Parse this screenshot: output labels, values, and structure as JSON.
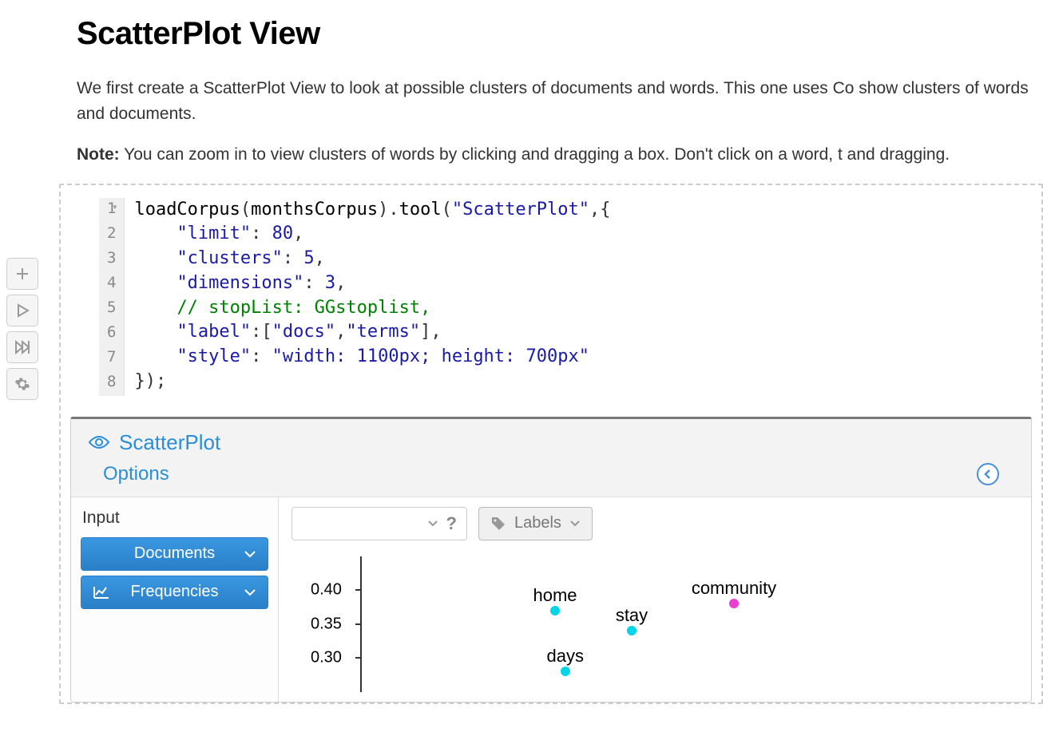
{
  "heading": "ScatterPlot View",
  "paragraph1": "We first create a ScatterPlot View to look at possible clusters of documents and words. This one uses Co show clusters of words and documents.",
  "note_label": "Note:",
  "note_text": " You can zoom in to view clusters of words by clicking and dragging a box. Don't click on a word, t and dragging.",
  "code": {
    "line_numbers": [
      "1",
      "2",
      "3",
      "4",
      "5",
      "6",
      "7",
      "8"
    ],
    "fn1": "loadCorpus",
    "arg1": "monthsCorpus",
    "fn2": "tool",
    "tool_name": "\"ScatterPlot\"",
    "k_limit": "\"limit\"",
    "v_limit": "80",
    "k_clusters": "\"clusters\"",
    "v_clusters": "5",
    "k_dimensions": "\"dimensions\"",
    "v_dimensions": "3",
    "comment": "// stopList: GGstoplist,",
    "k_label": "\"label\"",
    "v_label_a": "\"docs\"",
    "v_label_b": "\"terms\"",
    "k_style": "\"style\"",
    "v_style": "\"width: 1100px; height: 700px\"",
    "close": "});"
  },
  "tool": {
    "title": "ScatterPlot",
    "options": "Options",
    "input_label": "Input",
    "documents_btn": "Documents",
    "frequencies_btn": "Frequencies",
    "labels_btn": "Labels",
    "help": "?"
  },
  "chart_data": {
    "type": "scatter",
    "title": "",
    "xlabel": "",
    "ylabel": "",
    "ylim": [
      0.25,
      0.45
    ],
    "y_ticks": [
      0.4,
      0.35,
      0.3
    ],
    "series": [
      {
        "name": "cyan",
        "color": "#00d5e9",
        "points": [
          {
            "label": "home",
            "x": 0.35,
            "y": 0.37
          },
          {
            "label": "stay",
            "x": 0.5,
            "y": 0.34
          },
          {
            "label": "days",
            "x": 0.37,
            "y": 0.28
          }
        ]
      },
      {
        "name": "magenta",
        "color": "#e83fd0",
        "points": [
          {
            "label": "community",
            "x": 0.7,
            "y": 0.38
          }
        ]
      }
    ]
  }
}
